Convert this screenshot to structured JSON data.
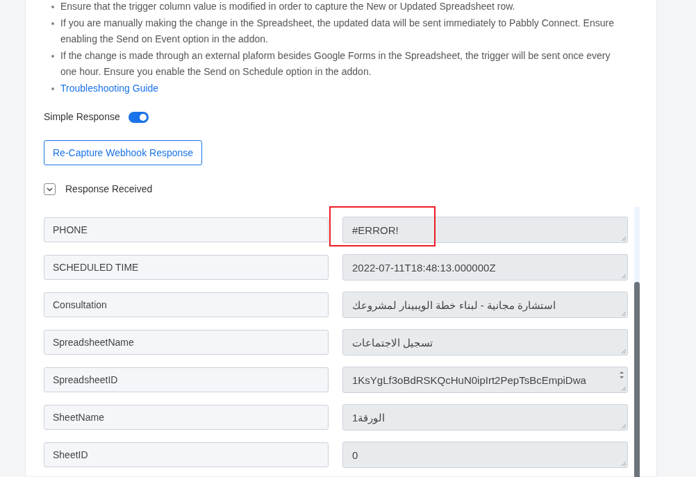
{
  "notes": [
    "Ensure that the trigger column value is modified in order to capture the New or Updated Spreadsheet row.",
    "If you are manually making the change in the Spreadsheet, the updated data will be sent immediately to Pabbly Connect. Ensure enabling the Send on Event option in the addon.",
    "If the change is made through an external plaform besides Google Forms in the Spreadsheet, the trigger will be sent once every one hour. Ensure you enable the Send on Schedule option in the addon."
  ],
  "troubleshooting_link": "Troubleshooting Guide",
  "simple_response": {
    "label": "Simple Response",
    "on": true
  },
  "recapture_button": "Re-Capture Webhook Response",
  "response_section": {
    "label": "Response Received",
    "expanded": true
  },
  "fields": [
    {
      "key": "PHONE",
      "value": "#ERROR!",
      "highlighted": true
    },
    {
      "key": "SCHEDULED TIME",
      "value": "2022-07-11T18:48:13.000000Z",
      "highlighted": false
    },
    {
      "key": "Consultation",
      "value": "استشارة مجانية - لبناء خطة الويبينار لمشروعك",
      "highlighted": false
    },
    {
      "key": "SpreadsheetName",
      "value": "تسجيل الاجتماعات",
      "highlighted": false
    },
    {
      "key": "SpreadsheetID",
      "value": "1KsYgLf3oBdRSKQcHuN0ipIrt2PepTsBcEmpiDwa",
      "highlighted": false,
      "spinner": true
    },
    {
      "key": "SheetName",
      "value": "الورقة1",
      "highlighted": false
    },
    {
      "key": "SheetID",
      "value": "0",
      "highlighted": false
    }
  ]
}
